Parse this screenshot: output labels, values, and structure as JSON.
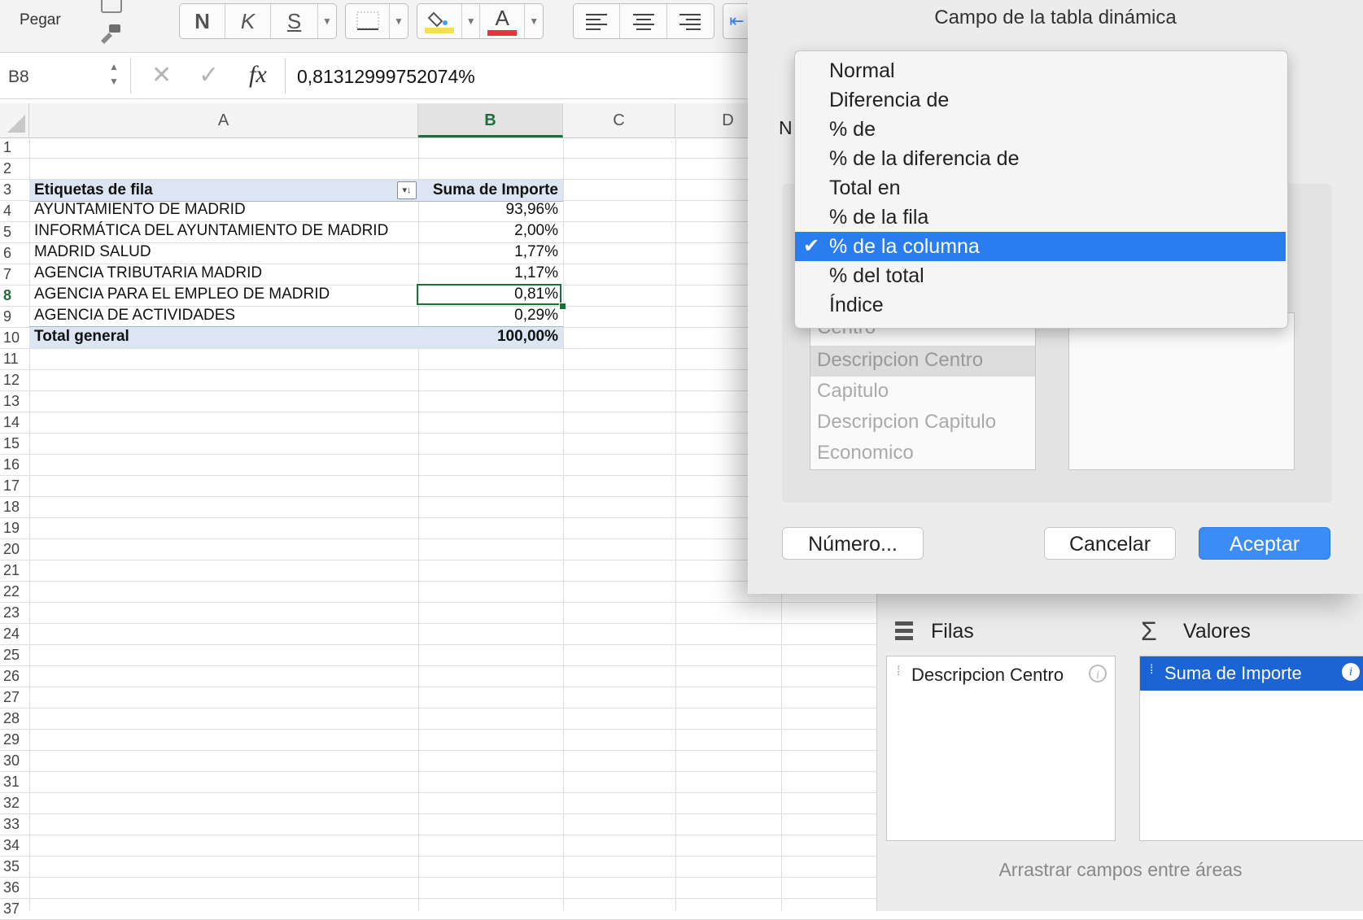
{
  "ribbon": {
    "paste_label": "Pegar",
    "bold": "N",
    "italic": "K",
    "underline": "S",
    "font_color_letter": "A",
    "fill_color": "#f4e04d",
    "font_color": "#e8343a"
  },
  "formula_bar": {
    "name_box": "B8",
    "fx_label": "fx",
    "value": "0,81312999752074%"
  },
  "sheet": {
    "columns": [
      "A",
      "B",
      "C",
      "D"
    ],
    "selected_column": "B",
    "row_numbers": [
      "1",
      "2",
      "3",
      "4",
      "5",
      "6",
      "7",
      "8",
      "9",
      "10",
      "11",
      "12",
      "13",
      "14",
      "15",
      "16",
      "17",
      "18",
      "19",
      "20",
      "21",
      "22",
      "23",
      "24",
      "25",
      "26",
      "27",
      "28",
      "29",
      "30",
      "31",
      "32",
      "33",
      "34",
      "35",
      "36",
      "37"
    ],
    "pivot": {
      "header_label": "Etiquetas de fila",
      "header_value": "Suma de Importe",
      "rows": [
        {
          "label": "AYUNTAMIENTO DE MADRID",
          "value": "93,96%"
        },
        {
          "label": "INFORMÁTICA DEL AYUNTAMIENTO DE MADRID",
          "value": "2,00%"
        },
        {
          "label": "MADRID SALUD",
          "value": "1,77%"
        },
        {
          "label": "AGENCIA TRIBUTARIA MADRID",
          "value": "1,17%"
        },
        {
          "label": "AGENCIA PARA EL EMPLEO DE MADRID",
          "value": "0,81%"
        },
        {
          "label": "AGENCIA DE ACTIVIDADES",
          "value": "0,29%"
        }
      ],
      "total_label": "Total general",
      "total_value": "100,00%"
    }
  },
  "dialog": {
    "title": "Campo de la tabla dinámica",
    "name_label_partial": "N",
    "show_values_menu": {
      "options": [
        "Normal",
        "Diferencia de",
        "% de",
        "% de la diferencia de",
        "Total en",
        "% de la fila",
        "% de la columna",
        "% del total",
        "Índice"
      ],
      "selected": "% de la columna"
    },
    "base_field_list": [
      "Centro",
      "Descripcion Centro",
      "Capitulo",
      "Descripcion Capitulo",
      "Economico"
    ],
    "number_button": "Número...",
    "cancel_button": "Cancelar",
    "accept_button": "Aceptar"
  },
  "field_panel": {
    "rows_title": "Filas",
    "values_title": "Valores",
    "rows_item": "Descripcion Centro",
    "values_item": "Suma de Importe",
    "hint": "Arrastrar campos entre áreas"
  }
}
